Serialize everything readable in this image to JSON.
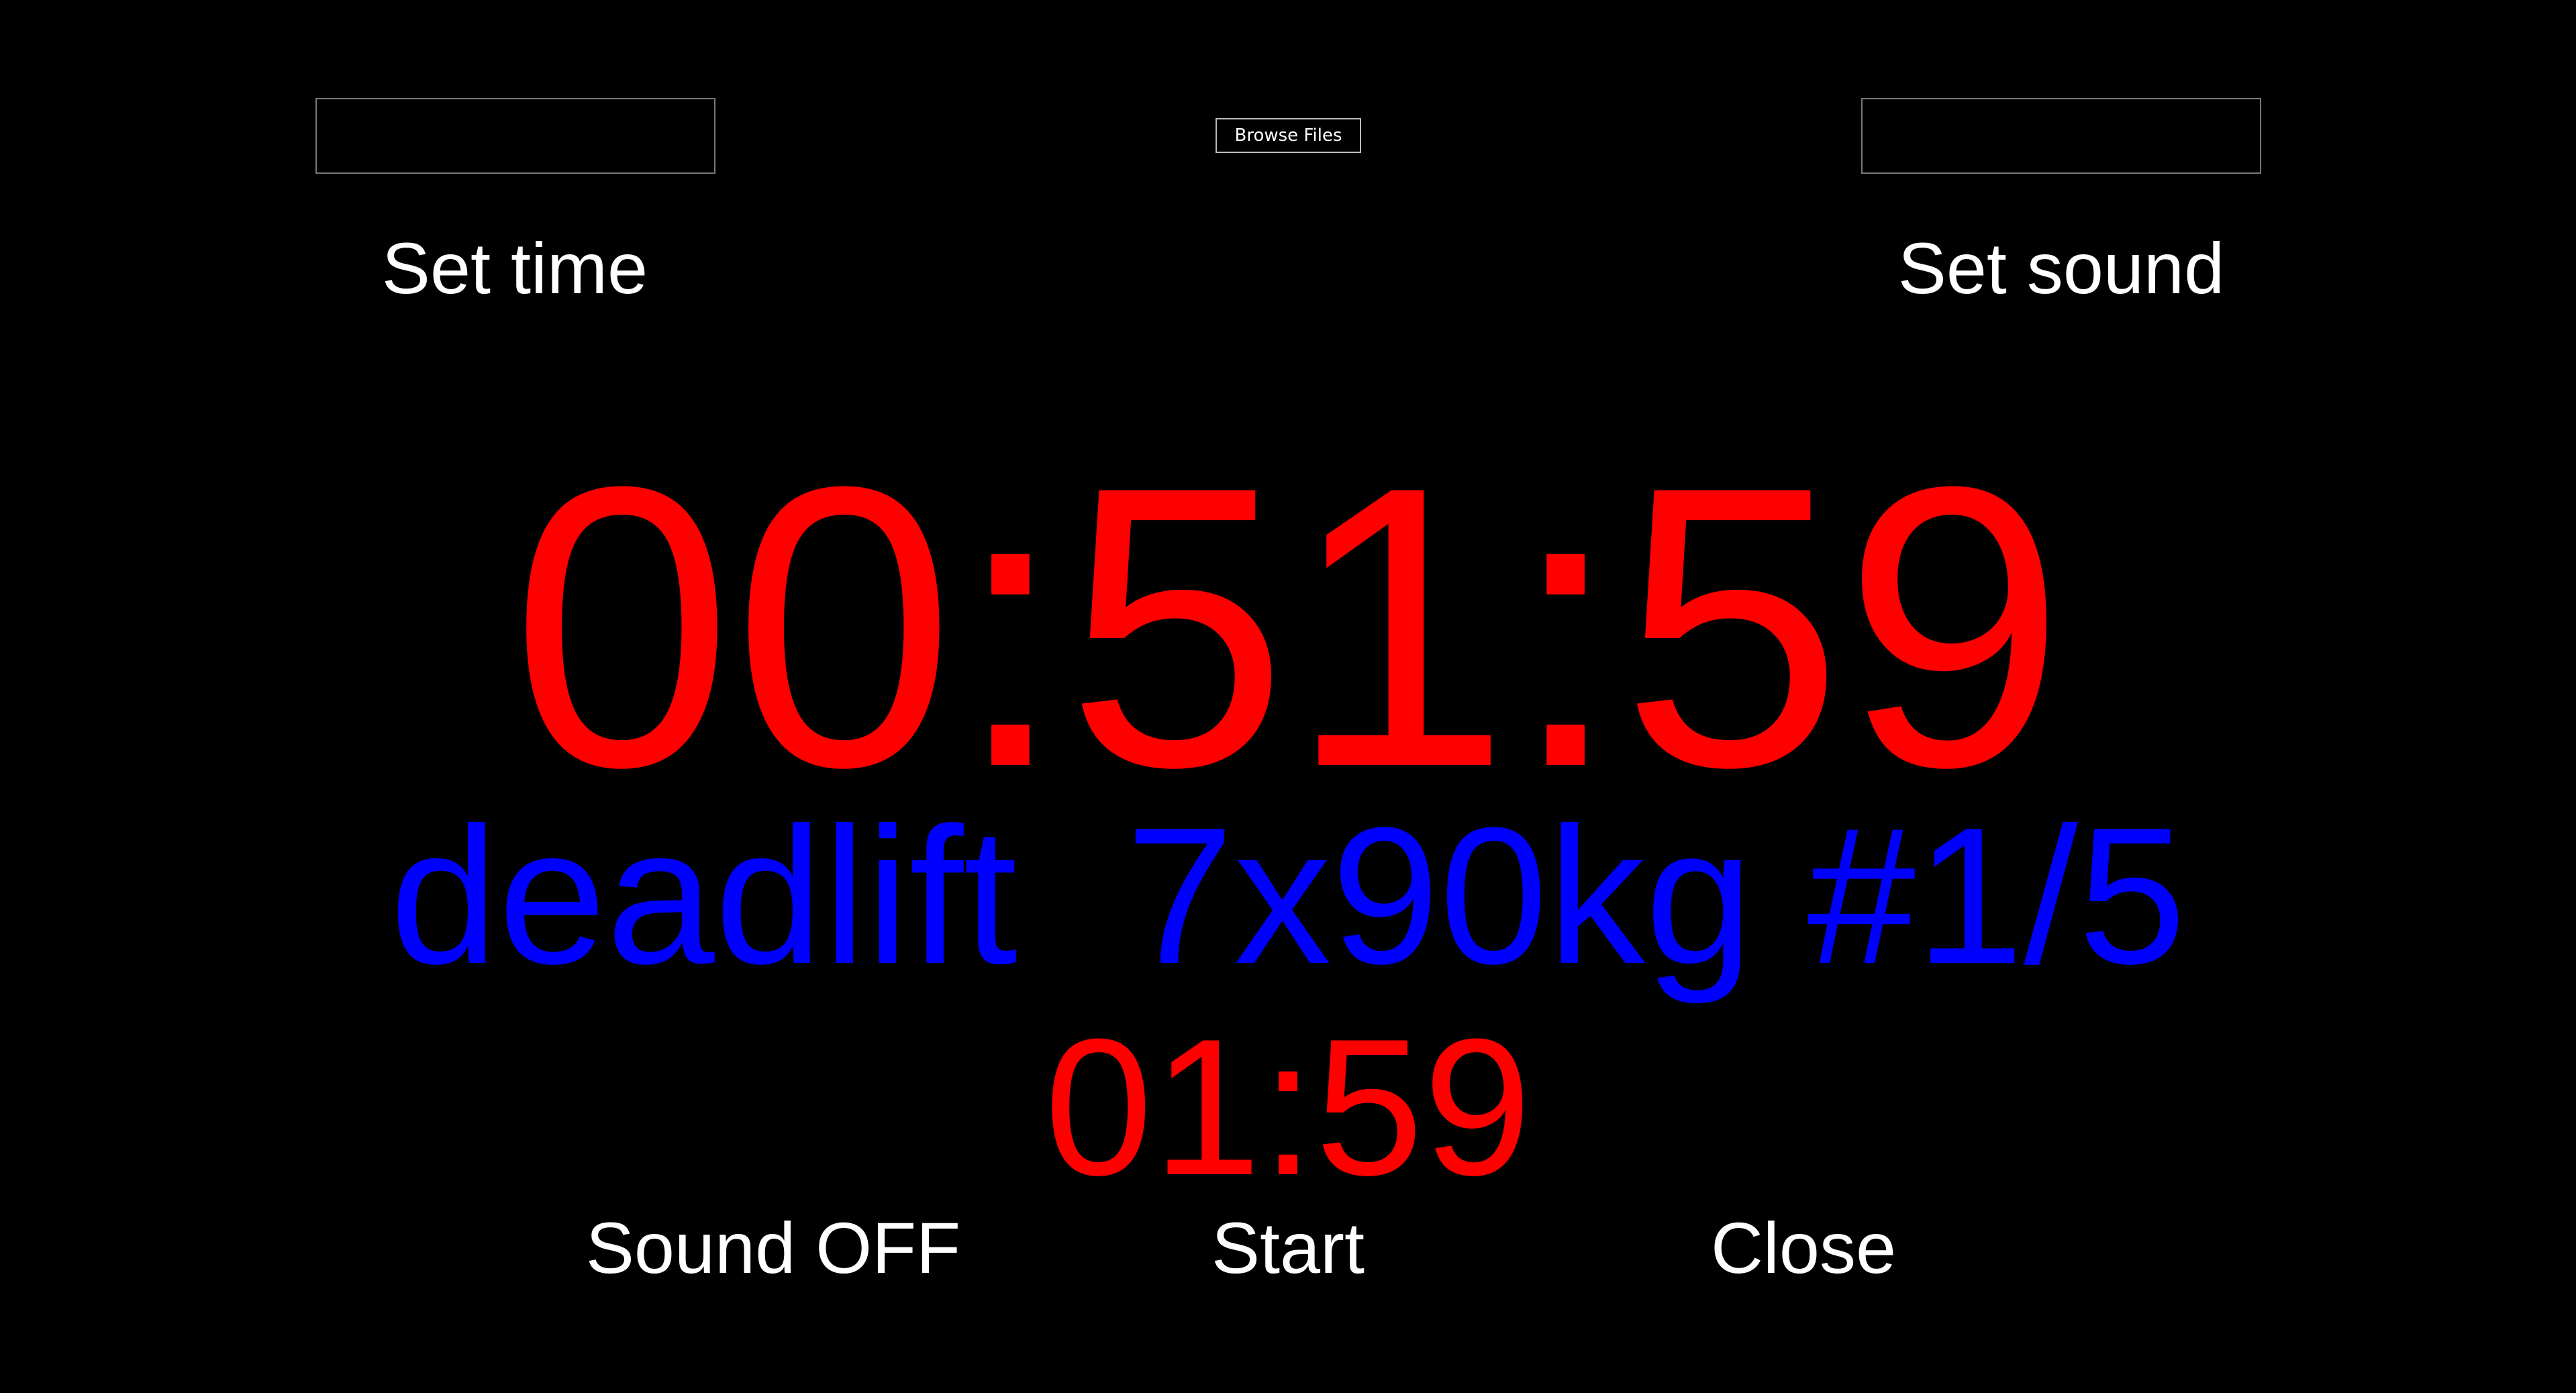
{
  "colors": {
    "background": "#000000",
    "label": "#ffffff",
    "timer": "#ff0000",
    "exercise": "#0000ff"
  },
  "top": {
    "time_input_value": "",
    "browse_label": "Browse Files",
    "sound_input_value": "",
    "set_time_label": "Set time",
    "set_sound_label": "Set sound"
  },
  "timer": {
    "main": "00:51:59",
    "exercise": "deadlift  7x90kg #1/5",
    "sub": "01:59"
  },
  "controls": {
    "sound_label": "Sound OFF",
    "start_label": "Start",
    "close_label": "Close"
  }
}
